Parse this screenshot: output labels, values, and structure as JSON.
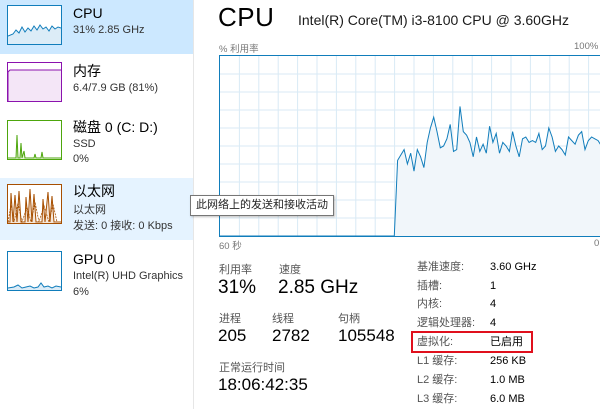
{
  "sidebar": {
    "items": [
      {
        "title": "CPU",
        "sub1": "31% 2.85 GHz",
        "sub2": "",
        "icon": "cpu-graph-icon"
      },
      {
        "title": "内存",
        "sub1": "6.4/7.9 GB (81%)",
        "sub2": "",
        "icon": "memory-graph-icon"
      },
      {
        "title": "磁盘 0 (C: D:)",
        "sub1": "SSD",
        "sub2": "0%",
        "icon": "disk-graph-icon"
      },
      {
        "title": "以太网",
        "sub1": "以太网",
        "sub2": "发送: 0 接收: 0 Kbps",
        "icon": "ethernet-graph-icon"
      },
      {
        "title": "GPU 0",
        "sub1": "Intel(R) UHD Graphics",
        "sub2": "6%",
        "icon": "gpu-graph-icon"
      }
    ]
  },
  "tooltip": "此网络上的发送和接收活动",
  "main": {
    "title": "CPU",
    "cpu_model": "Intel(R) Core(TM) i3-8100 CPU @ 3.60GHz",
    "graph_ylabel": "% 利用率",
    "graph_ymax": "100%",
    "graph_xlabel_left": "60 秒",
    "graph_xlabel_right": "0",
    "stats": {
      "util_label": "利用率",
      "util_value": "31%",
      "speed_label": "速度",
      "speed_value": "2.85 GHz",
      "proc_label": "进程",
      "proc_value": "205",
      "thread_label": "线程",
      "thread_value": "2782",
      "handle_label": "句柄",
      "handle_value": "105548",
      "uptime_label": "正常运行时间",
      "uptime_value": "18:06:42:35"
    },
    "details": [
      {
        "label": "基准速度:",
        "value": "3.60 GHz"
      },
      {
        "label": "插槽:",
        "value": "1"
      },
      {
        "label": "内核:",
        "value": "4"
      },
      {
        "label": "逻辑处理器:",
        "value": "4"
      },
      {
        "label": "虚拟化:",
        "value": "已启用"
      },
      {
        "label": "L1 缓存:",
        "value": "256 KB"
      },
      {
        "label": "L2 缓存:",
        "value": "1.0 MB"
      },
      {
        "label": "L3 缓存:",
        "value": "6.0 MB"
      }
    ]
  },
  "colors": {
    "cpu": "#117dbb",
    "memory": "#8b12ae",
    "disk": "#4da60c",
    "ethernet": "#a74f01",
    "gpu": "#117dbb",
    "highlight": "#e0101d",
    "selected_bg": "#cce8ff",
    "hover_bg": "#e5f3ff"
  },
  "cpu_graph": {
    "utilization_percent": [
      0,
      0,
      0,
      0,
      0,
      0,
      0,
      0,
      0,
      0,
      0,
      0,
      0,
      0,
      0,
      0,
      0,
      0,
      0,
      0,
      0,
      0,
      0,
      0,
      0,
      0,
      0,
      0,
      0,
      0,
      0,
      0,
      0,
      0,
      0,
      0,
      0,
      0,
      0,
      0,
      0,
      0,
      0,
      0,
      0,
      0,
      0,
      0,
      0,
      0,
      0,
      0,
      0,
      0,
      42,
      45,
      48,
      40,
      46,
      36,
      48,
      44,
      38,
      52,
      60,
      66,
      58,
      49,
      50,
      54,
      62,
      47,
      48,
      72,
      58,
      56,
      52,
      44,
      55,
      47,
      51,
      46,
      61,
      52,
      57,
      46,
      52,
      50,
      47,
      58,
      50,
      44,
      54,
      55,
      52,
      53,
      52,
      57,
      48,
      50,
      60,
      55,
      47,
      50,
      48,
      45,
      55,
      53,
      51,
      56,
      58,
      48,
      53,
      55,
      54,
      53,
      50,
      55,
      58
    ]
  }
}
